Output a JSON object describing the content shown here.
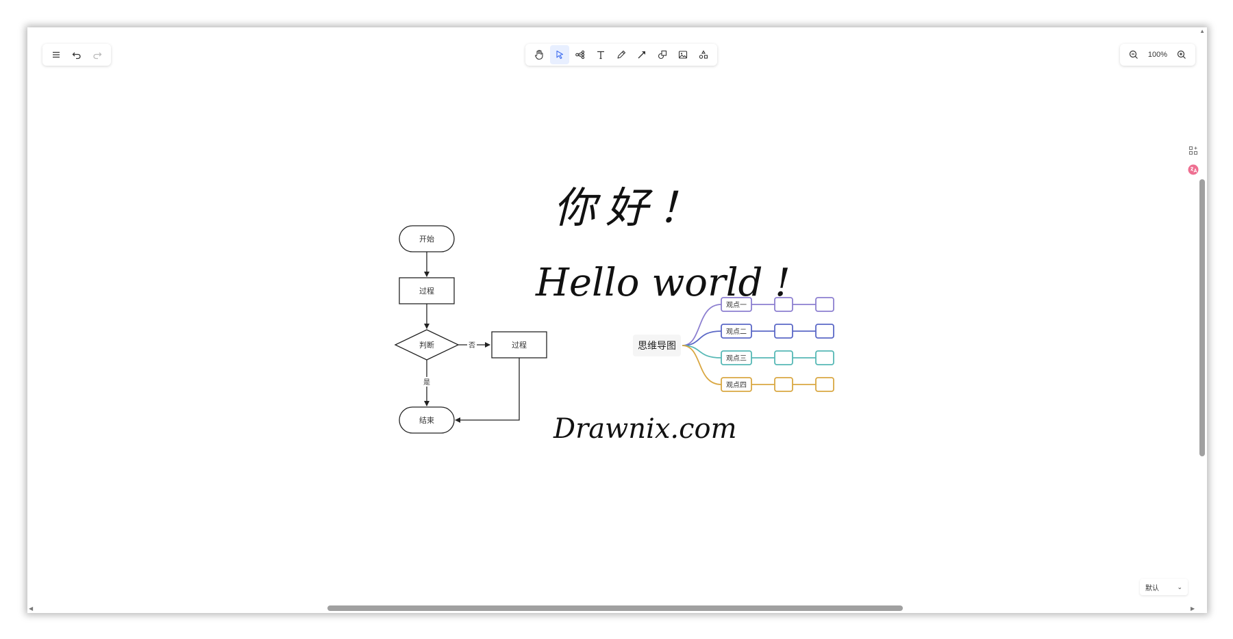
{
  "toolbar_left": {
    "menu_icon": "menu-icon",
    "undo_icon": "undo-icon",
    "redo_icon": "redo-icon"
  },
  "toolbar_center": {
    "tools": [
      "hand-icon",
      "pointer-icon",
      "mind-map-icon",
      "text-icon",
      "pen-icon",
      "arrow-icon",
      "shapes-icon",
      "image-icon",
      "extra-tools-icon"
    ],
    "active_tool": "pointer-icon"
  },
  "zoom": {
    "level": "100%"
  },
  "flowchart": {
    "start": "开始",
    "process1": "过程",
    "decision": "判断",
    "no_label": "否",
    "yes_label": "是",
    "process2": "过程",
    "end": "结束"
  },
  "handwriting": {
    "line1": "你好！",
    "line2": "Hello world !",
    "line3": "Drawnix.com"
  },
  "mindmap": {
    "root": "思维导图",
    "branches": [
      {
        "label": "观点一",
        "color": "#8c7fd0"
      },
      {
        "label": "观点二",
        "color": "#5a67c6"
      },
      {
        "label": "观点三",
        "color": "#56b8b5"
      },
      {
        "label": "观点四",
        "color": "#d9a742"
      }
    ]
  },
  "theme_select": {
    "value": "默认"
  },
  "colors": {
    "accent": "#3d6cf0",
    "avatar": "#ee6f91"
  }
}
